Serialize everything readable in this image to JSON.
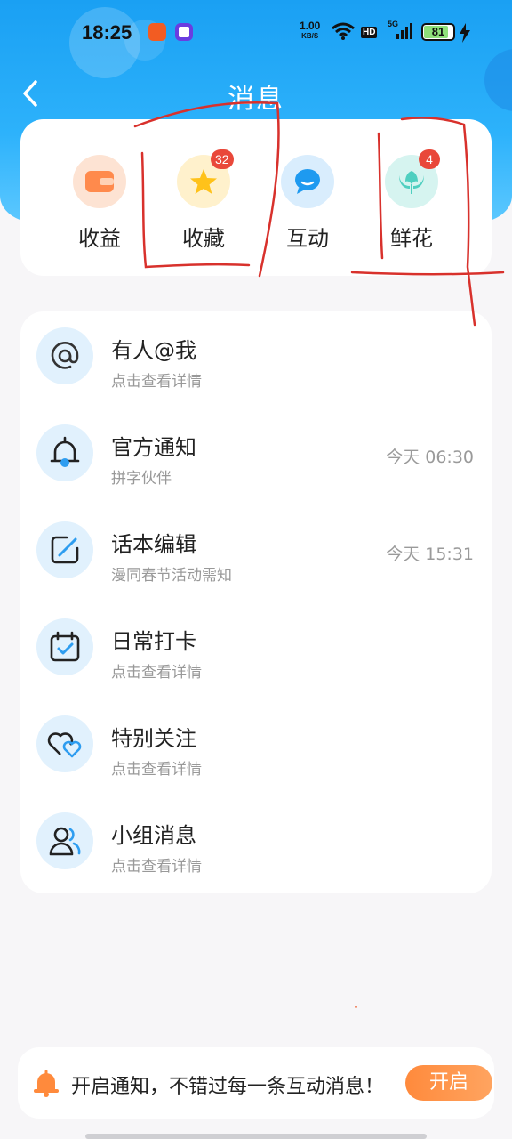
{
  "status_bar": {
    "time": "18:25",
    "net_speed": "1.00",
    "net_unit": "KB/S",
    "hd": "HD",
    "signal": "5G",
    "battery": "81"
  },
  "header": {
    "title": "消息",
    "back_icon": "chevron-left-icon"
  },
  "quick_actions": [
    {
      "label": "收益",
      "icon": "wallet-icon",
      "color": "#ff8a4c",
      "badge": ""
    },
    {
      "label": "收藏",
      "icon": "star-icon",
      "color": "#ffc21a",
      "badge": "32"
    },
    {
      "label": "互动",
      "icon": "chat-bubble-icon",
      "color": "#1e9af0",
      "badge": ""
    },
    {
      "label": "鲜花",
      "icon": "flower-icon",
      "color": "#4fcfc0",
      "badge": "4"
    }
  ],
  "messages": [
    {
      "title": "有人@我",
      "subtitle": "点击查看详情",
      "time": "",
      "icon": "at-sign-icon"
    },
    {
      "title": "官方通知",
      "subtitle": "拼字伙伴",
      "time": "今天 06:30",
      "icon": "bell-icon"
    },
    {
      "title": "话本编辑",
      "subtitle": "漫同春节活动需知",
      "time": "今天 15:31",
      "icon": "edit-icon"
    },
    {
      "title": "日常打卡",
      "subtitle": "点击查看详情",
      "time": "",
      "icon": "calendar-check-icon"
    },
    {
      "title": "特别关注",
      "subtitle": "点击查看详情",
      "time": "",
      "icon": "hearts-icon"
    },
    {
      "title": "小组消息",
      "subtitle": "点击查看详情",
      "time": "",
      "icon": "group-icon"
    }
  ],
  "notify_banner": {
    "text": "开启通知，不错过每一条互动消息！",
    "button": "开启",
    "icon": "bell-icon"
  },
  "colors": {
    "primary": "#1aa0f3",
    "accent": "#ff8a3c",
    "badge": "#e9483a",
    "annotation": "#d8312c"
  }
}
